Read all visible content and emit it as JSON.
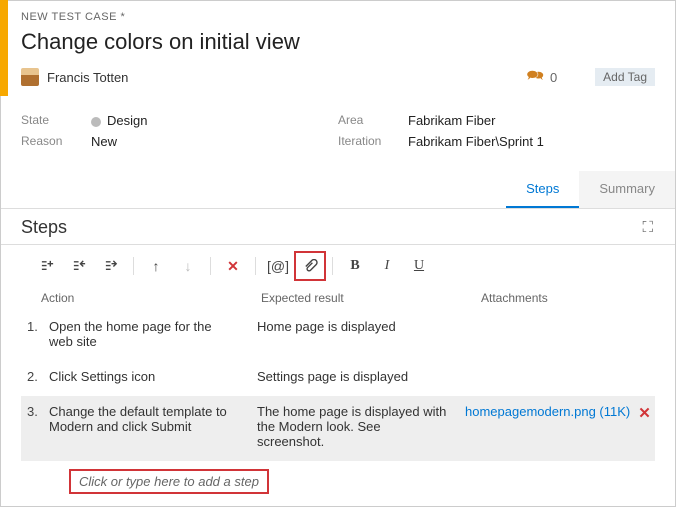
{
  "breadcrumb": "NEW TEST CASE *",
  "title": "Change colors on initial view",
  "user_name": "Francis Totten",
  "discussion_count": "0",
  "add_tag_label": "Add Tag",
  "meta": {
    "state_label": "State",
    "state_value": "Design",
    "reason_label": "Reason",
    "reason_value": "New",
    "area_label": "Area",
    "area_value": "Fabrikam Fiber",
    "iteration_label": "Iteration",
    "iteration_value": "Fabrikam Fiber\\Sprint 1"
  },
  "tabs": {
    "steps": "Steps",
    "summary": "Summary"
  },
  "section_title": "Steps",
  "toolbar": {
    "params": "[@]",
    "bold": "B",
    "italic": "I",
    "underline": "U",
    "delete": "✕"
  },
  "column_headers": {
    "action": "Action",
    "expected": "Expected result",
    "attachments": "Attachments"
  },
  "steps": [
    {
      "num": "1.",
      "action": "Open the home page for the web site",
      "expected": "Home page is displayed",
      "attachment": ""
    },
    {
      "num": "2.",
      "action": "Click Settings icon",
      "expected": "Settings page is displayed",
      "attachment": ""
    },
    {
      "num": "3.",
      "action": "Change the default template to Modern and click Submit",
      "expected": "The home page is displayed with the Modern look. See screenshot.",
      "attachment": "homepagemodern.png (11K)"
    }
  ],
  "new_step_placeholder": "Click or type here to add a step"
}
